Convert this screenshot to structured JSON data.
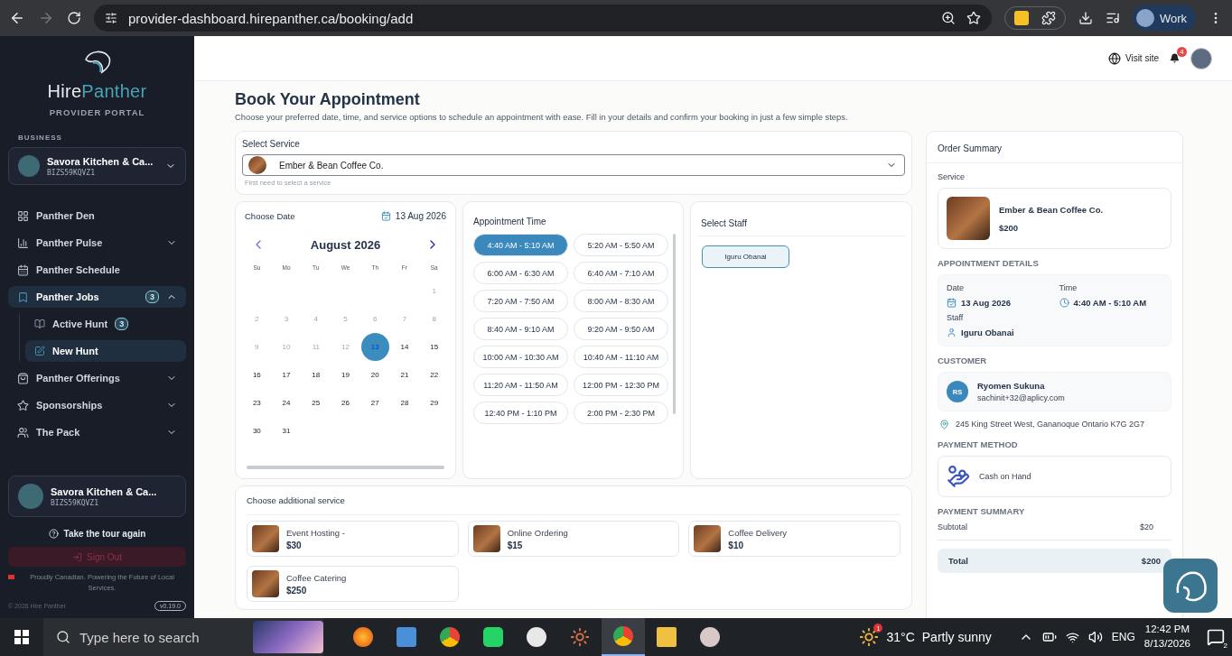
{
  "browser": {
    "url": "provider-dashboard.hirepanther.ca/booking/add",
    "profile": "Work"
  },
  "sidebar": {
    "logo_first": "Hire",
    "logo_second": "Panther",
    "portal": "PROVIDER PORTAL",
    "section": "BUSINESS",
    "business": {
      "name": "Savora Kitchen & Ca...",
      "id": "BIZS59KQVZ1"
    },
    "nav": [
      {
        "kind": "link",
        "label": "Panther Den",
        "selected": false
      },
      {
        "kind": "group",
        "label": "Panther Pulse",
        "selected": false,
        "expanded": false
      },
      {
        "kind": "link",
        "label": "Panther Schedule",
        "selected": false
      },
      {
        "kind": "group",
        "label": "Panther Jobs",
        "selected": true,
        "expanded": true,
        "badge": "3",
        "children": [
          {
            "label": "Active Hunt",
            "selected": false,
            "badge": "3"
          },
          {
            "label": "New Hunt",
            "selected": true
          }
        ]
      },
      {
        "kind": "group",
        "label": "Panther Offerings",
        "selected": false,
        "expanded": false
      },
      {
        "kind": "group",
        "label": "Sponsorships",
        "selected": false,
        "expanded": false
      },
      {
        "kind": "group",
        "label": "The Pack",
        "selected": false,
        "expanded": false
      }
    ],
    "account": {
      "name": "Savora Kitchen & Ca...",
      "id": "BIZS59KQVZ1"
    },
    "tour": "Take the tour again",
    "sign_out": "Sign Out",
    "tagline": "Proudly Canadian. Powering the Future of Local Services.",
    "copyright": "© 2026 Hire Panther",
    "version": "v0.19.0"
  },
  "header": {
    "visit_site": "Visit site",
    "notifications": "4"
  },
  "booking": {
    "title": "Book Your Appointment",
    "subtitle": "Choose your preferred date, time, and service options to schedule an appointment with ease. Fill in your details and confirm your booking in just a few simple steps.",
    "service": {
      "label": "Select Service",
      "value": "Ember & Bean Coffee Co.",
      "hint": "First need to select a service"
    },
    "date": {
      "label": "Choose Date",
      "picked": "13 Aug 2026",
      "month": "August 2026",
      "weekdays": [
        "Su",
        "Mo",
        "Tu",
        "We",
        "Th",
        "Fr",
        "Sa"
      ],
      "days": [
        {
          "label": "1",
          "disabled": true,
          "selected": false
        },
        {
          "label": "2",
          "disabled": true,
          "selected": false
        },
        {
          "label": "3",
          "disabled": true,
          "selected": false
        },
        {
          "label": "4",
          "disabled": true,
          "selected": false
        },
        {
          "label": "5",
          "disabled": true,
          "selected": false
        },
        {
          "label": "6",
          "disabled": true,
          "selected": false
        },
        {
          "label": "7",
          "disabled": true,
          "selected": false
        },
        {
          "label": "8",
          "disabled": true,
          "selected": false
        },
        {
          "label": "9",
          "disabled": true,
          "selected": false
        },
        {
          "label": "10",
          "disabled": true,
          "selected": false
        },
        {
          "label": "11",
          "disabled": true,
          "selected": false
        },
        {
          "label": "12",
          "disabled": true,
          "selected": false
        },
        {
          "label": "13",
          "disabled": false,
          "selected": true
        },
        {
          "label": "14",
          "disabled": false,
          "selected": false
        },
        {
          "label": "15",
          "disabled": false,
          "selected": false
        },
        {
          "label": "16",
          "disabled": false,
          "selected": false
        },
        {
          "label": "17",
          "disabled": false,
          "selected": false
        },
        {
          "label": "18",
          "disabled": false,
          "selected": false
        },
        {
          "label": "19",
          "disabled": false,
          "selected": false
        },
        {
          "label": "20",
          "disabled": false,
          "selected": false
        },
        {
          "label": "21",
          "disabled": false,
          "selected": false
        },
        {
          "label": "22",
          "disabled": false,
          "selected": false
        },
        {
          "label": "23",
          "disabled": false,
          "selected": false
        },
        {
          "label": "24",
          "disabled": false,
          "selected": false
        },
        {
          "label": "25",
          "disabled": false,
          "selected": false
        },
        {
          "label": "26",
          "disabled": false,
          "selected": false
        },
        {
          "label": "27",
          "disabled": false,
          "selected": false
        },
        {
          "label": "28",
          "disabled": false,
          "selected": false
        },
        {
          "label": "29",
          "disabled": false,
          "selected": false
        },
        {
          "label": "30",
          "disabled": false,
          "selected": false
        },
        {
          "label": "31",
          "disabled": false,
          "selected": false
        }
      ]
    },
    "time": {
      "title": "Appointment Time",
      "slots": [
        {
          "label": "4:40 AM - 5:10 AM",
          "selected": true
        },
        {
          "label": "5:20 AM - 5:50 AM",
          "selected": false
        },
        {
          "label": "6:00 AM - 6:30 AM",
          "selected": false
        },
        {
          "label": "6:40 AM - 7:10 AM",
          "selected": false
        },
        {
          "label": "7:20 AM - 7:50 AM",
          "selected": false
        },
        {
          "label": "8:00 AM - 8:30 AM",
          "selected": false
        },
        {
          "label": "8:40 AM - 9:10 AM",
          "selected": false
        },
        {
          "label": "9:20 AM - 9:50 AM",
          "selected": false
        },
        {
          "label": "10:00 AM - 10:30 AM",
          "selected": false
        },
        {
          "label": "10:40 AM - 11:10 AM",
          "selected": false
        },
        {
          "label": "11:20 AM - 11:50 AM",
          "selected": false
        },
        {
          "label": "12:00 PM - 12:30 PM",
          "selected": false
        },
        {
          "label": "12:40 PM - 1:10 PM",
          "selected": false
        },
        {
          "label": "2:00 PM - 2:30 PM",
          "selected": false
        }
      ]
    },
    "staff": {
      "title": "Select Staff",
      "members": [
        {
          "name": "Iguru Obanai",
          "selected": true
        }
      ]
    },
    "additional": {
      "title": "Choose additional service",
      "items": [
        {
          "name": "Event Hosting -",
          "price": "$30"
        },
        {
          "name": "Online Ordering",
          "price": "$15"
        },
        {
          "name": "Coffee Delivery",
          "price": "$10"
        },
        {
          "name": "Coffee Catering",
          "price": "$250"
        }
      ]
    }
  },
  "summary": {
    "title": "Order Summary",
    "service_label": "Service",
    "service_name": "Ember & Bean Coffee Co.",
    "service_price": "$200",
    "details_heading": "APPOINTMENT DETAILS",
    "date_label": "Date",
    "date": "13 Aug 2026",
    "time_label": "Time",
    "time": "4:40 AM - 5:10 AM",
    "staff_label": "Staff",
    "staff": "Iguru Obanai",
    "customer_heading": "CUSTOMER",
    "initials": "RS",
    "customer_name": "Ryomen Sukuna",
    "email": "sachinit+32@aplicy.com",
    "address": "245 King Street West, Gananoque Ontario K7G 2G7",
    "payment_heading": "PAYMENT METHOD",
    "payment_method": "Cash on Hand",
    "payment_summary_heading": "PAYMENT SUMMARY",
    "subtotal_label": "Subtotal",
    "subtotal": "$20",
    "total_label": "Total",
    "total": "$200"
  },
  "taskbar": {
    "search": "Type here to search",
    "weather_badge": "1",
    "temperature": "31°C",
    "condition": "Partly sunny",
    "language": "ENG",
    "time": "12:42 PM",
    "date": "8/13/2026",
    "notifications": "2"
  }
}
